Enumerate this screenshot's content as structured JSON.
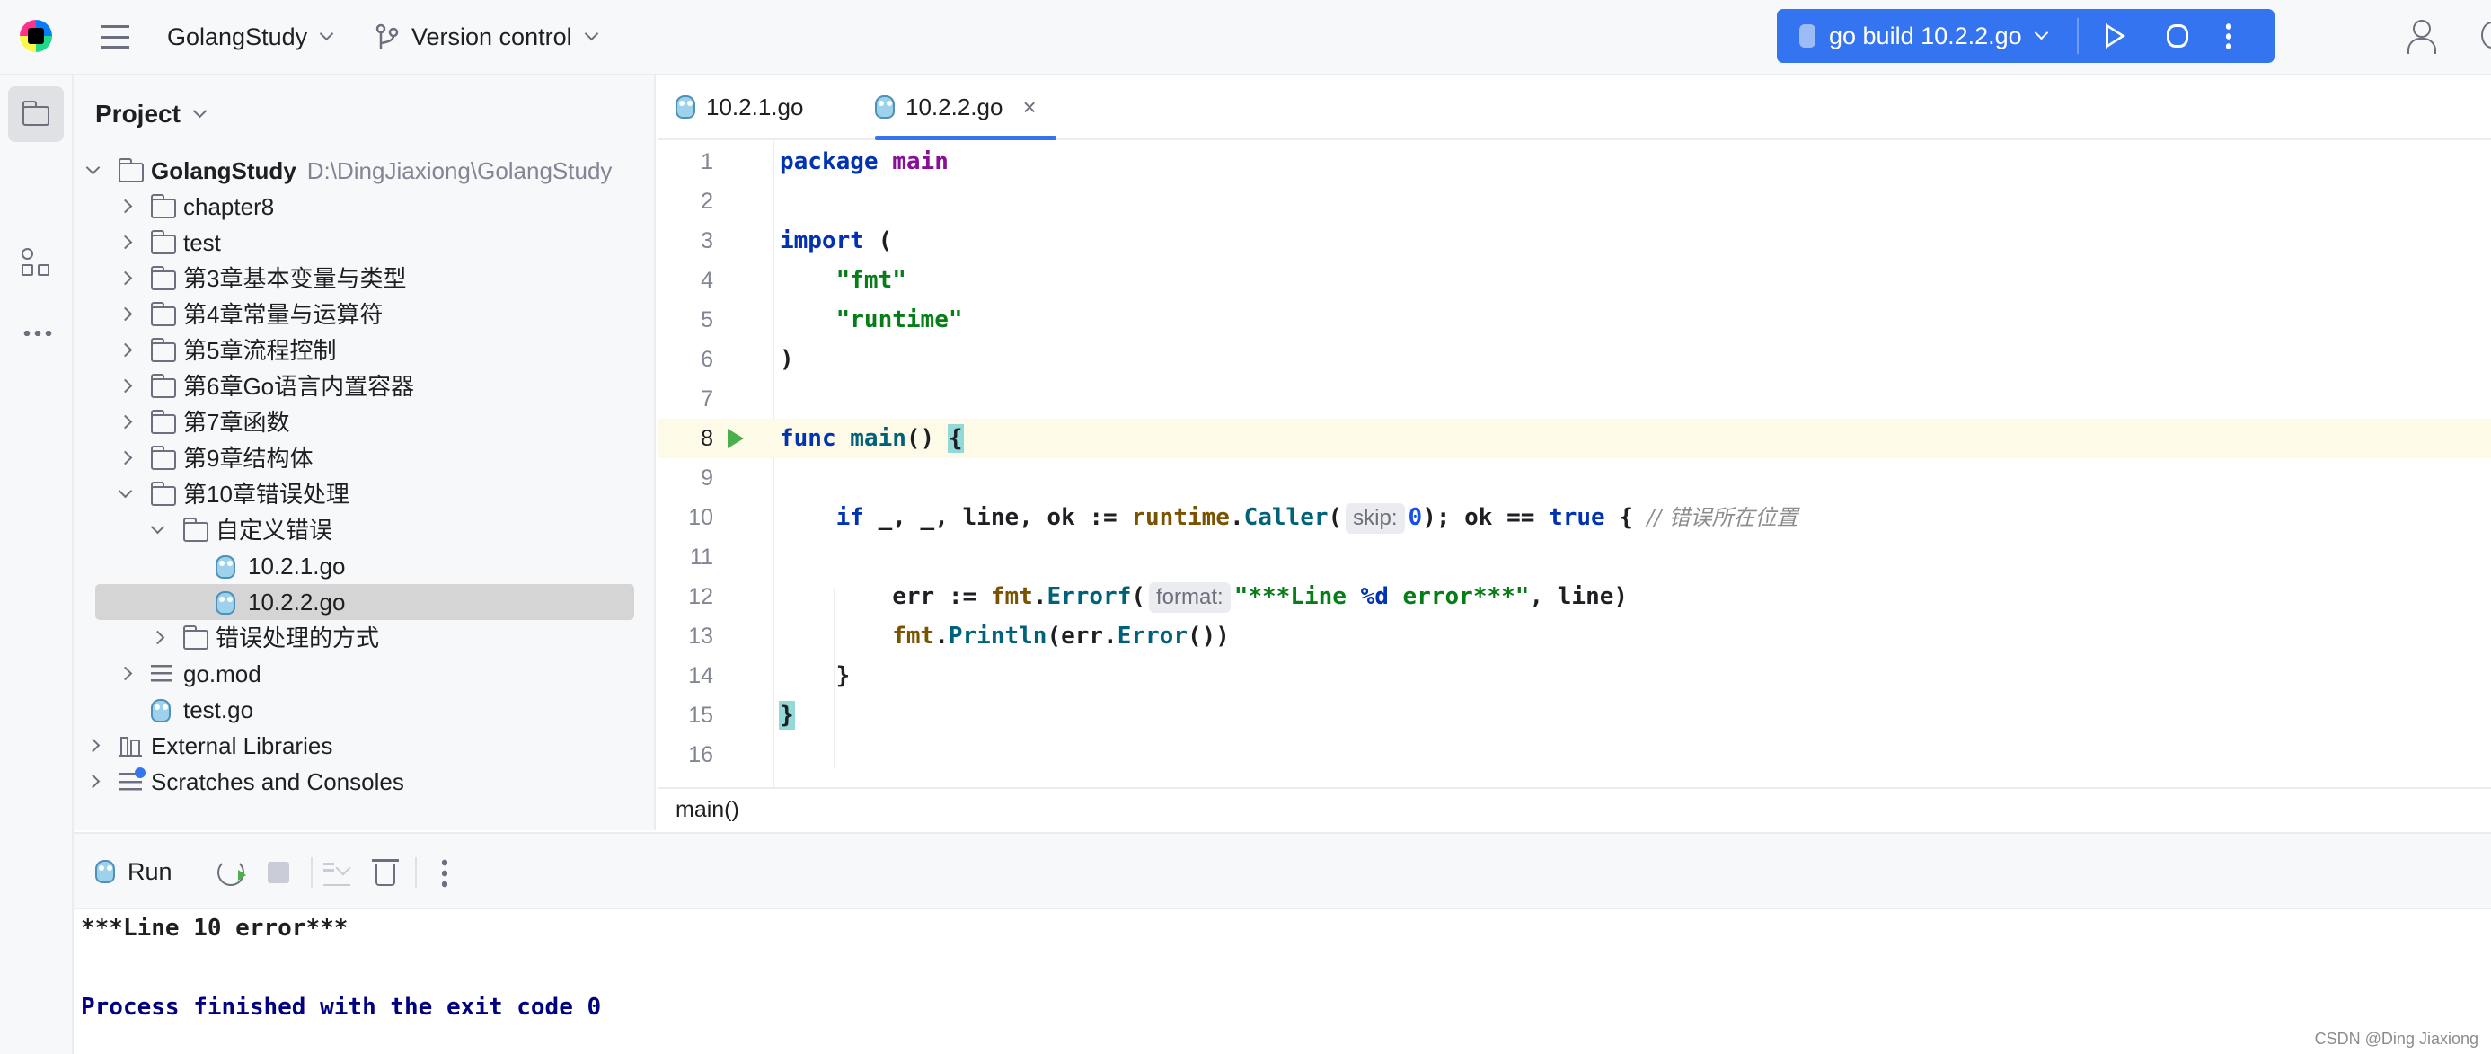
{
  "toolbar": {
    "project_name": "GolangStudy",
    "vcs_label": "Version control",
    "run_config": "go build 10.2.2.go"
  },
  "project_panel": {
    "title": "Project",
    "tree": [
      {
        "label": "GolangStudy",
        "path": "D:\\DingJiaxiong\\GolangStudy",
        "type": "folder",
        "expanded": true
      },
      {
        "label": "chapter8",
        "type": "folder"
      },
      {
        "label": "test",
        "type": "folder"
      },
      {
        "label": "第3章基本变量与类型",
        "type": "folder"
      },
      {
        "label": "第4章常量与运算符",
        "type": "folder"
      },
      {
        "label": "第5章流程控制",
        "type": "folder"
      },
      {
        "label": "第6章Go语言内置容器",
        "type": "folder"
      },
      {
        "label": "第7章函数",
        "type": "folder"
      },
      {
        "label": "第9章结构体",
        "type": "folder"
      },
      {
        "label": "第10章错误处理",
        "type": "folder",
        "expanded": true
      },
      {
        "label": "自定义错误",
        "type": "folder",
        "expanded": true
      },
      {
        "label": "10.2.1.go",
        "type": "gofile"
      },
      {
        "label": "10.2.2.go",
        "type": "gofile",
        "selected": true
      },
      {
        "label": "错误处理的方式",
        "type": "folder"
      },
      {
        "label": "go.mod",
        "type": "mod"
      },
      {
        "label": "test.go",
        "type": "gofile"
      },
      {
        "label": "External Libraries",
        "type": "lib"
      },
      {
        "label": "Scratches and Consoles",
        "type": "scratch"
      }
    ]
  },
  "editor": {
    "tabs": [
      {
        "label": "10.2.1.go"
      },
      {
        "label": "10.2.2.go",
        "active": true
      }
    ],
    "close_glyph": "×",
    "line_numbers": [
      "1",
      "2",
      "3",
      "4",
      "5",
      "6",
      "7",
      "8",
      "9",
      "10",
      "11",
      "12",
      "13",
      "14",
      "15",
      "16"
    ],
    "hints": {
      "skip": "skip:",
      "format": "format:"
    },
    "comment_text": "错误所在位置",
    "breadcrumb": "main()"
  },
  "run_panel": {
    "tab_label": "Run",
    "output": [
      "***Line 10 error***",
      "Process finished with the exit code 0"
    ]
  },
  "watermark": "CSDN @Ding Jiaxiong",
  "colors": {
    "accent": "#3574f0",
    "keyword": "#0033b3",
    "string": "#067d17",
    "function": "#00627a",
    "package": "#871094"
  }
}
